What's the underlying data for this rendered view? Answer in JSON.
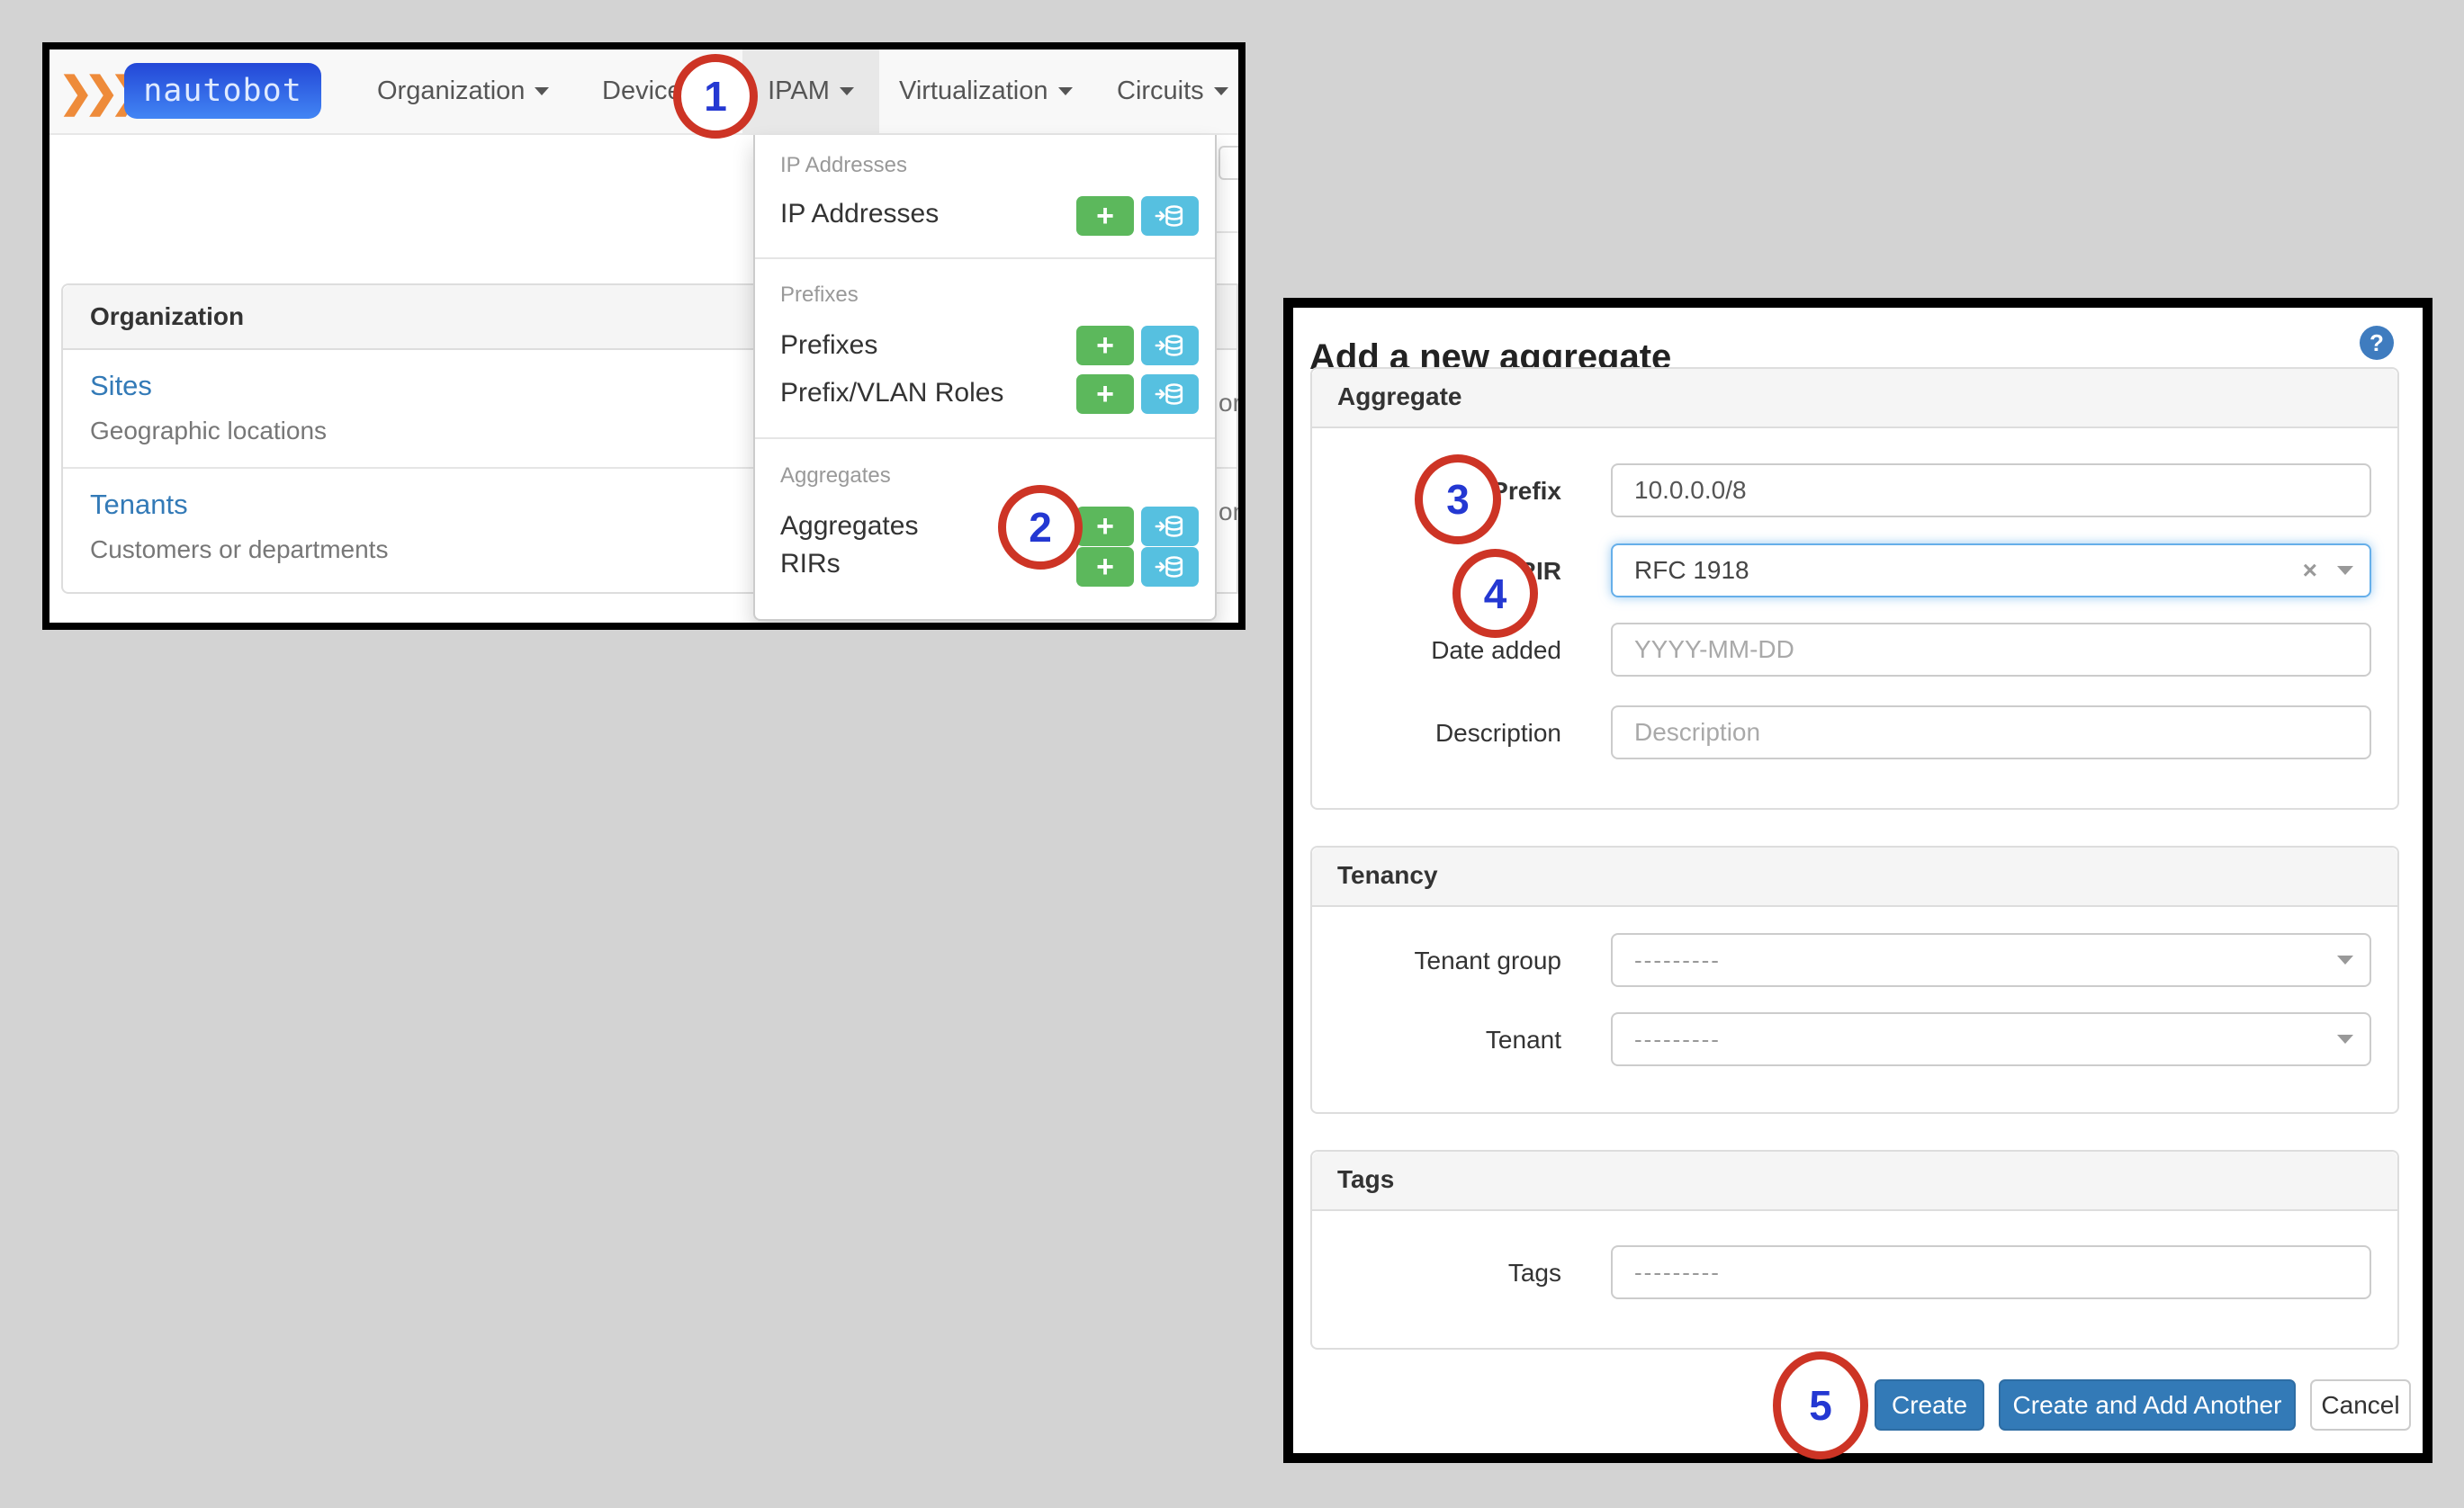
{
  "annotations": {
    "steps": [
      "1",
      "2",
      "3",
      "4",
      "5"
    ],
    "circle_color": "#cd3425",
    "number_color": "#2438d2"
  },
  "left_window": {
    "navbar": {
      "logo_chevrons": "❯❯❯",
      "logo_text": "nautobot",
      "items": [
        {
          "label": "Organization"
        },
        {
          "label": "Devices"
        },
        {
          "label": "IPAM",
          "active": true
        },
        {
          "label": "Virtualization"
        },
        {
          "label": "Circuits"
        }
      ]
    },
    "dropdown": {
      "add_button_glyph": "+",
      "import_icon": "database-import",
      "sections": [
        {
          "header": "IP Addresses",
          "items": [
            {
              "label": "IP Addresses"
            }
          ]
        },
        {
          "header": "Prefixes",
          "items": [
            {
              "label": "Prefixes"
            },
            {
              "label": "Prefix/VLAN Roles"
            }
          ]
        },
        {
          "header": "Aggregates",
          "items": [
            {
              "label": "Aggregates"
            },
            {
              "label": "RIRs"
            }
          ]
        }
      ]
    },
    "page": {
      "card": {
        "header": "Organization",
        "items": [
          {
            "title": "Sites",
            "subtitle": "Geographic locations"
          },
          {
            "title": "Tenants",
            "subtitle": "Customers or departments"
          }
        ]
      },
      "clipped_fragments": [
        "or",
        "on"
      ]
    }
  },
  "right_window": {
    "title": "Add a new aggregate",
    "help_icon": "?",
    "panels": [
      {
        "header": "Aggregate",
        "fields": [
          {
            "label": "Prefix",
            "required": true,
            "value": "10.0.0.0/8"
          },
          {
            "label": "RIR",
            "required": true,
            "value": "RFC 1918",
            "clear_glyph": "×"
          },
          {
            "label": "Date added",
            "placeholder": "YYYY-MM-DD"
          },
          {
            "label": "Description",
            "placeholder": "Description"
          }
        ]
      },
      {
        "header": "Tenancy",
        "fields": [
          {
            "label": "Tenant group",
            "placeholder": "---------"
          },
          {
            "label": "Tenant",
            "placeholder": "---------"
          }
        ]
      },
      {
        "header": "Tags",
        "fields": [
          {
            "label": "Tags",
            "placeholder": "---------"
          }
        ]
      }
    ],
    "buttons": [
      {
        "label": "Create",
        "style": "primary"
      },
      {
        "label": "Create and Add Another",
        "style": "primary"
      },
      {
        "label": "Cancel",
        "style": "default"
      }
    ],
    "colors": {
      "button_primary": "#337ab7",
      "focus_blue": "#66afe9",
      "link_blue": "#337ab7",
      "add_green": "#5cb85c",
      "import_blue": "#56c0e0",
      "logo_orange": "#ee8b3a"
    }
  }
}
